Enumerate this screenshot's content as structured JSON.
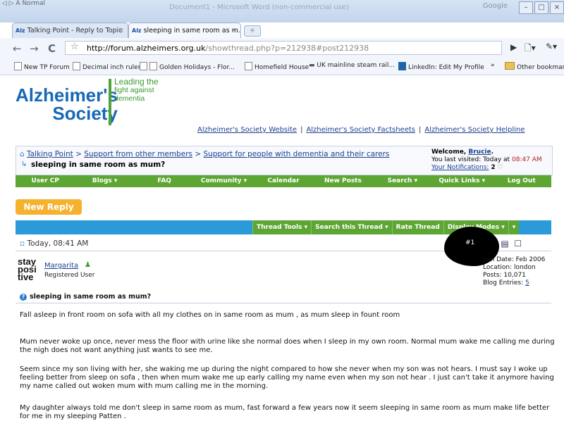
{
  "window": {
    "old_tabs_text": "Normal",
    "title_ghost": "Document1 - Microsoft Word (non-commercial use)",
    "google_label": "Google",
    "minimize": "–",
    "maximize": "□",
    "close": "×"
  },
  "tabs": [
    {
      "icon": "Alz",
      "label": "Talking Point - Reply to Topic"
    },
    {
      "icon": "Alz",
      "label": "sleeping in same room as m..."
    }
  ],
  "toolbar": {
    "url_host": "http://forum.alzheimers.org.uk",
    "url_path": "/showthread.php?p=212938#post212938"
  },
  "bookmarks": [
    "New TP Forum",
    "Decimal inch ruler",
    "Golden Holidays - Flor...",
    "Homefield House",
    "UK mainline steam rail...",
    "LinkedIn: Edit My Profile",
    "Other bookmarks"
  ],
  "logo": {
    "line1": "Alzheimer's",
    "line2": "Society",
    "tag1": "Leading the",
    "tag2": "fight against",
    "tag3": "dementia"
  },
  "top_links": [
    "Alzheimer's Society Website",
    "Alzheimer's Society Factsheets",
    "Alzheimer's Society Helpline"
  ],
  "breadcrumb": [
    "Talking Point",
    "Support from other members",
    "Support for people with dementia and their carers"
  ],
  "thread_title": "sleeping in same room as mum?",
  "welcome": {
    "label": "Welcome,",
    "user": "Brucie",
    "last_visit": "You last visited: Today at",
    "last_time": "08:47 AM",
    "notifications": "Your Notifications:",
    "notif_count": "2"
  },
  "navbar": [
    "User CP",
    "Blogs ▾",
    "FAQ",
    "Community ▾",
    "Calendar",
    "New Posts",
    "Search ▾",
    "Quick Links ▾",
    "Log Out"
  ],
  "new_reply": "New Reply",
  "thread_tools": [
    "Thread Tools ▾",
    "Search this Thread ▾",
    "Rate Thread",
    "Display Modes ▾",
    "▾"
  ],
  "post": {
    "date": "Today, 08:41 AM",
    "number": "#1",
    "avatar_lines": [
      "stay",
      "posi",
      "tive"
    ],
    "username": "Margarita",
    "user_title": "Registered User",
    "join_date": "Join Date: Feb 2006",
    "location": "Location: london",
    "posts": "Posts: 10,071",
    "blog_label": "Blog Entries:",
    "blog_count": "5",
    "subject": "sleeping in same room as mum?",
    "paragraphs": [
      "Fall asleep in front room on sofa with all my clothes on in same room as mum , as mum sleep in fount room",
      "Mum never woke up once, never mess the floor with urine like she normal does when I sleep in my own room. Normal mum wake me calling me during the nigh does not want anything just wants to see me.",
      "Seem since my son living with her, she waking me up during the night compared to how she never when my son was not hears. I must say I woke up feeling better from sleep on sofa , then when mum wake me up early calling my name even when my son not hear . I just can't take it anymore having my name called out woken mum with mum calling me in the morning.",
      "My daughter always told me don't sleep in same room as mum, fast forward a few years now it seem sleeping in same room as mum make life better for me in my sleeping Patten ."
    ]
  },
  "colors": {
    "brand_blue": "#1768b5",
    "brand_green": "#5ea634",
    "accent_orange": "#f6b12e",
    "bar_blue": "#2a9bd8"
  }
}
